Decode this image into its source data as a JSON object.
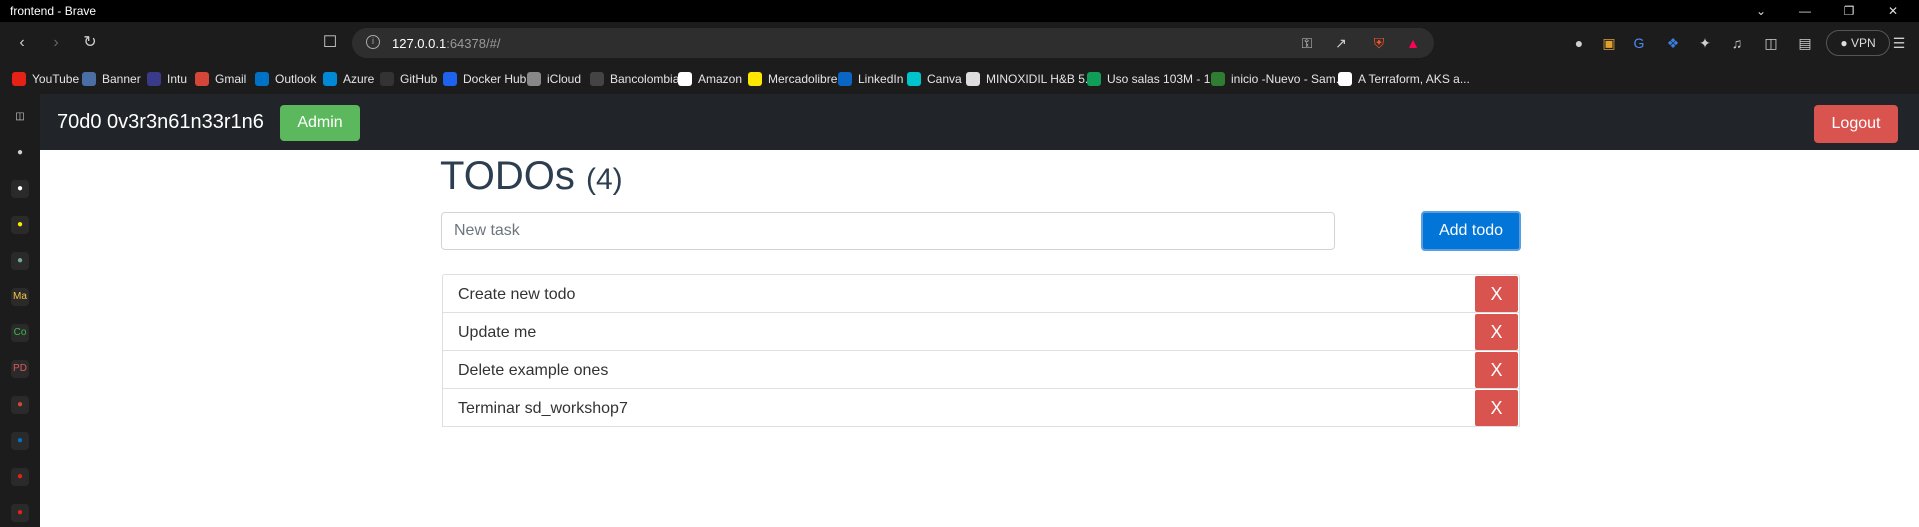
{
  "window": {
    "title": "frontend - Brave",
    "controls": [
      "chevron-down-icon",
      "minimize-icon",
      "restore-icon",
      "close-icon"
    ]
  },
  "toolbar": {
    "url_host": "127.0.0.1",
    "url_rest": ":64378/#/",
    "vpn_label": "VPN"
  },
  "bookmarks": [
    {
      "label": "YouTube",
      "icon": "youtube-icon",
      "color": "#e62117"
    },
    {
      "label": "Banner",
      "icon": "banner-icon",
      "color": "#4a6fa5"
    },
    {
      "label": "Intu",
      "icon": "intu-icon",
      "color": "#3a3a8a"
    },
    {
      "label": "Gmail",
      "icon": "gmail-icon",
      "color": "#d44638"
    },
    {
      "label": "Outlook",
      "icon": "outlook-icon",
      "color": "#0072c6"
    },
    {
      "label": "Azure",
      "icon": "azure-icon",
      "color": "#0089d6"
    },
    {
      "label": "GitHub",
      "icon": "github-icon",
      "color": "#333333"
    },
    {
      "label": "Docker Hub",
      "icon": "docker-icon",
      "color": "#1d63ed"
    },
    {
      "label": "iCloud",
      "icon": "apple-icon",
      "color": "#888888"
    },
    {
      "label": "Bancolombia",
      "icon": "bancolombia-icon",
      "color": "#444444"
    },
    {
      "label": "Amazon",
      "icon": "amazon-icon",
      "color": "#ffffff"
    },
    {
      "label": "Mercadolibre",
      "icon": "mercadolibre-icon",
      "color": "#ffe600"
    },
    {
      "label": "LinkedIn",
      "icon": "linkedin-icon",
      "color": "#0a66c2"
    },
    {
      "label": "Canva",
      "icon": "canva-icon",
      "color": "#00c4cc"
    },
    {
      "label": "MINOXIDIL H&B 5...",
      "icon": "minoxidil-icon",
      "color": "#dddddd"
    },
    {
      "label": "Uso salas 103M - 1...",
      "icon": "sheets-icon",
      "color": "#0f9d58"
    },
    {
      "label": "inicio -Nuevo - Sam...",
      "icon": "sam-icon",
      "color": "#2e7d32"
    },
    {
      "label": "A Terraform, AKS a...",
      "icon": "medium-icon",
      "color": "#ffffff"
    }
  ],
  "sidebar_icons": [
    {
      "icon": "sidebar-panel-icon",
      "color": "#cfcfcf"
    },
    {
      "icon": "globe-icon",
      "color": "#cfcfcf"
    },
    {
      "icon": "amazon-icon",
      "color": "#ffffff"
    },
    {
      "icon": "mercadolibre-icon",
      "color": "#ffe600"
    },
    {
      "icon": "chatgpt-icon",
      "color": "#74aa9c"
    },
    {
      "icon": "Ma",
      "color": "#f4c542"
    },
    {
      "icon": "Co",
      "color": "#3fb950"
    },
    {
      "icon": "PD",
      "color": "#e05a5a"
    },
    {
      "icon": "gmail-icon",
      "color": "#d44638"
    },
    {
      "icon": "outlook-icon",
      "color": "#0072c6"
    },
    {
      "icon": "youtube-icon",
      "color": "#e62117"
    },
    {
      "icon": "youtube-icon",
      "color": "#e62117"
    }
  ],
  "app": {
    "brand": "70d0 0v3r3n61n33r1n6",
    "admin_label": "Admin",
    "logout_label": "Logout",
    "heading": "TODOs",
    "count": "(4)",
    "input_placeholder": "New task",
    "add_label": "Add todo",
    "delete_label": "X",
    "colors": {
      "admin": "#5cb85c",
      "danger": "#d9534f",
      "primary": "#0275d8",
      "navbar": "#212529"
    },
    "todos": [
      "Create new todo",
      "Update me",
      "Delete example ones",
      "Terminar sd_workshop7"
    ]
  }
}
